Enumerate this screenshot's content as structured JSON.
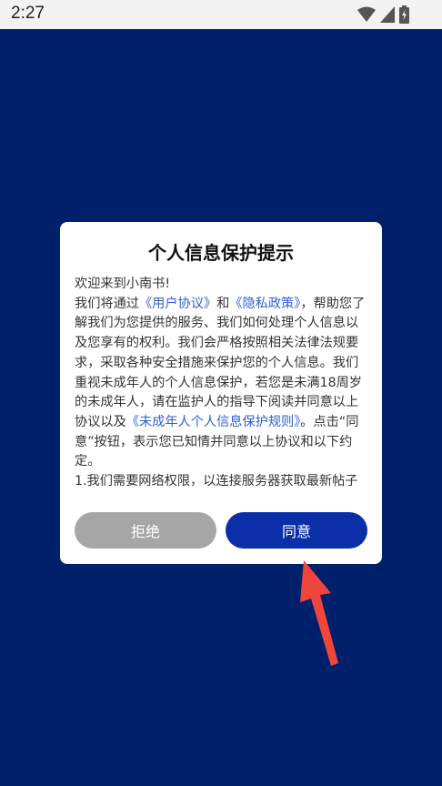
{
  "status_bar": {
    "time": "2:27"
  },
  "dialog": {
    "title": "个人信息保护提示",
    "greeting": "欢迎来到小南书!",
    "para1": {
      "prefix": "我们将通过",
      "link_user": "《用户协议》",
      "and": "和",
      "link_privacy": "《隐私政策》",
      "middle": "，帮助您了解我们为您提供的服务、我们如何处理个人信息以及您享有的权利。我们会严格按照相关法律法规要求，采取各种安全措施来保护您的个人信息。我们重视未成年人的个人信息保护，若您是未满18周岁的未成年人，请在监护人的指导下阅读并同意以上协议以及",
      "link_minor": "《未成年人个人信息保护规则》",
      "suffix": "。点击“同意”按钮，表示您已知情并同意以上协议和以下约定。"
    },
    "item1": "1.我们需要网络权限，以连接服务器获取最新帖子",
    "reject_label": "拒绝",
    "agree_label": "同意"
  },
  "colors": {
    "backdrop": "#00206b",
    "link": "#2f5fd6",
    "agree_button": "#0a2fa8",
    "reject_button": "#a6a6a6",
    "annotation_arrow": "#f0453a"
  },
  "icons": [
    "wifi-icon",
    "cellular-signal-icon",
    "battery-charging-icon",
    "annotation-arrow-icon"
  ]
}
